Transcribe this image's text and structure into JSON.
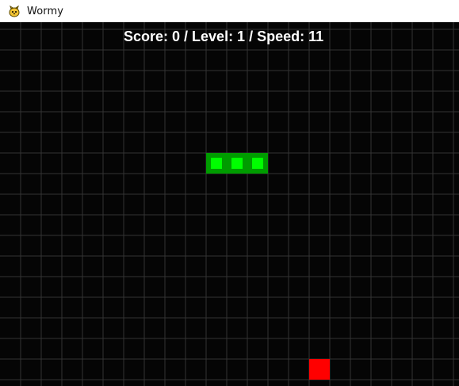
{
  "window": {
    "title": "Wormy",
    "icon": "pygame-snake-icon"
  },
  "hud": {
    "text": "Score: 0 / Level: 1 / Speed: 11"
  },
  "game": {
    "background_color": "#050505",
    "grid_color": "#343434",
    "worm_outer_color": "#009c00",
    "worm_inner_color": "#00ff00",
    "apple_color": "#ff0000",
    "worm_segments": [
      {
        "col": 9,
        "row": 6
      },
      {
        "col": 10,
        "row": 6
      },
      {
        "col": 11,
        "row": 6
      }
    ],
    "apple": {
      "col": 14,
      "row": 16
    },
    "score": 0,
    "level": 1,
    "speed": 11
  }
}
